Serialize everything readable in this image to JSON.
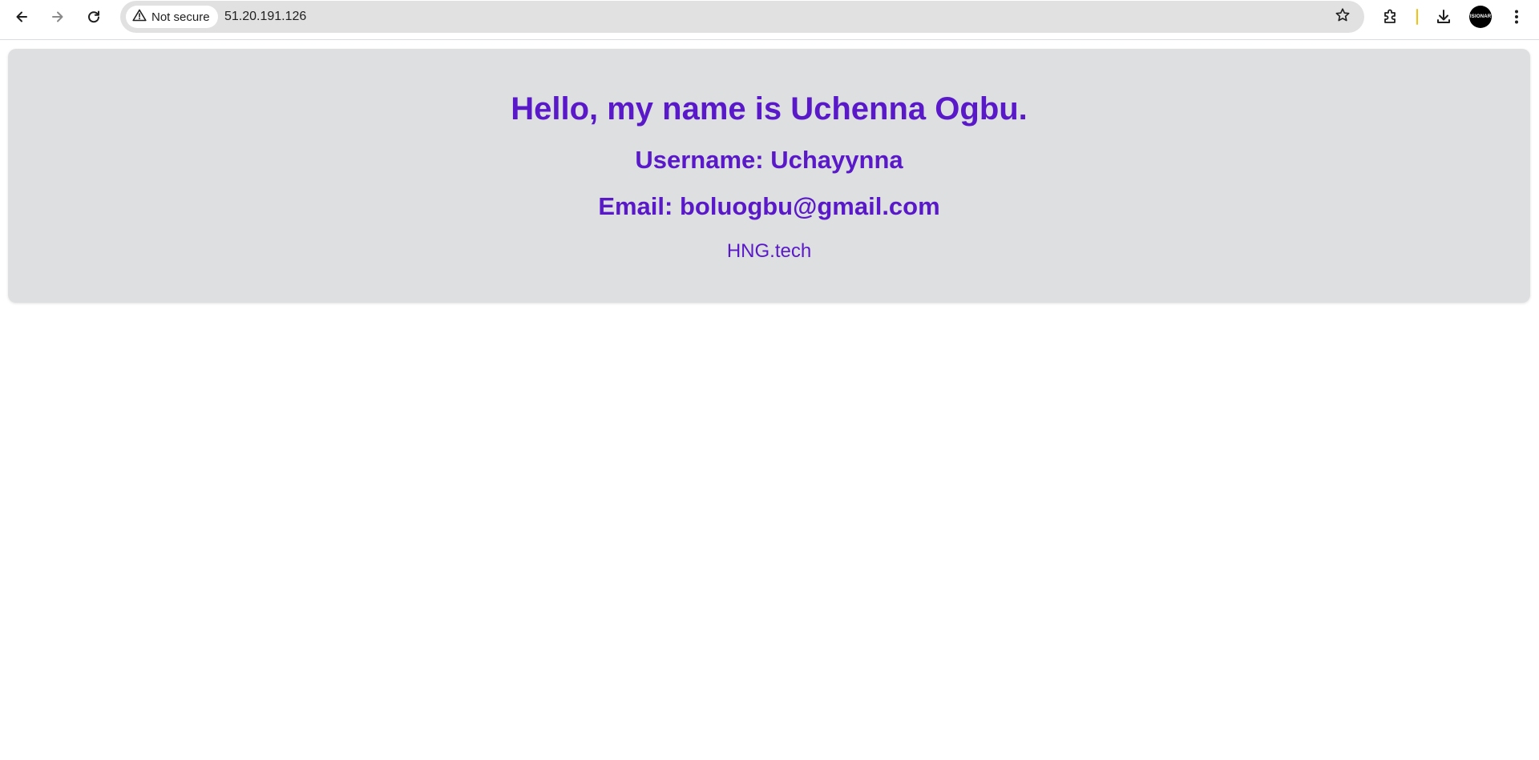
{
  "browser": {
    "address_bar": {
      "security_label": "Not secure",
      "url": "51.20.191.126"
    },
    "icons": {
      "back": "arrow-left-icon",
      "forward": "arrow-right-icon",
      "reload": "reload-icon",
      "warning": "warning-triangle-icon",
      "bookmark": "star-icon",
      "extensions": "puzzle-icon",
      "downloads": "download-icon",
      "menu": "kebab-menu-icon"
    },
    "profile_avatar_text": "VISIONARY"
  },
  "page": {
    "heading": "Hello, my name is Uchenna Ogbu.",
    "username_line": "Username: Uchayynna",
    "email_line": "Email: boluogbu@gmail.com",
    "link_text": "HNG.tech"
  },
  "colors": {
    "accent_text": "#5a19c9",
    "card_background": "#dedfe0",
    "omnibox_background": "#e1e1e1",
    "divider_accent": "#f4c20d"
  }
}
